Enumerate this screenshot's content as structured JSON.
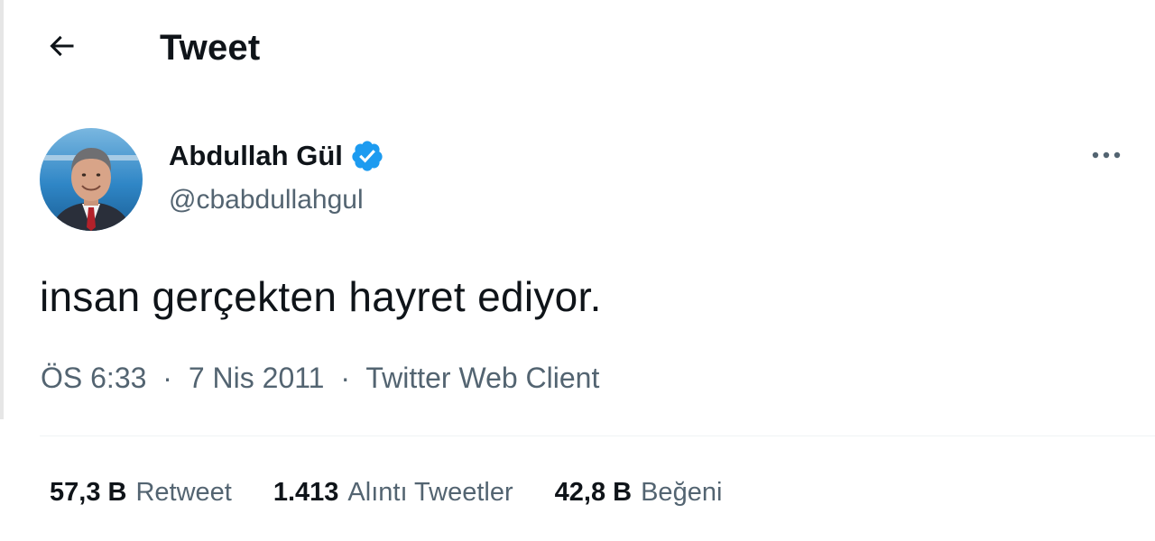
{
  "header": {
    "back_icon": "arrow-left-icon",
    "title": "Tweet"
  },
  "author": {
    "name": "Abdullah Gül",
    "handle": "@cbabdullahgul",
    "verified_icon": "verified-badge-icon",
    "more_icon": "more-horizontal-icon"
  },
  "tweet": {
    "text": "insan gerçekten hayret ediyor.",
    "time": "ÖS 6:33",
    "separator": "·",
    "date": "7 Nis 2011",
    "source": "Twitter Web Client"
  },
  "stats": {
    "retweets": {
      "value": "57,3 B",
      "label": "Retweet"
    },
    "quotes": {
      "value": "1.413",
      "label": "Alıntı Tweetler"
    },
    "likes": {
      "value": "42,8 B",
      "label": "Beğeni"
    }
  },
  "colors": {
    "text_primary": "#0f1419",
    "text_secondary": "#536471",
    "verified_blue": "#1d9bf0",
    "divider": "#eff3f4"
  }
}
